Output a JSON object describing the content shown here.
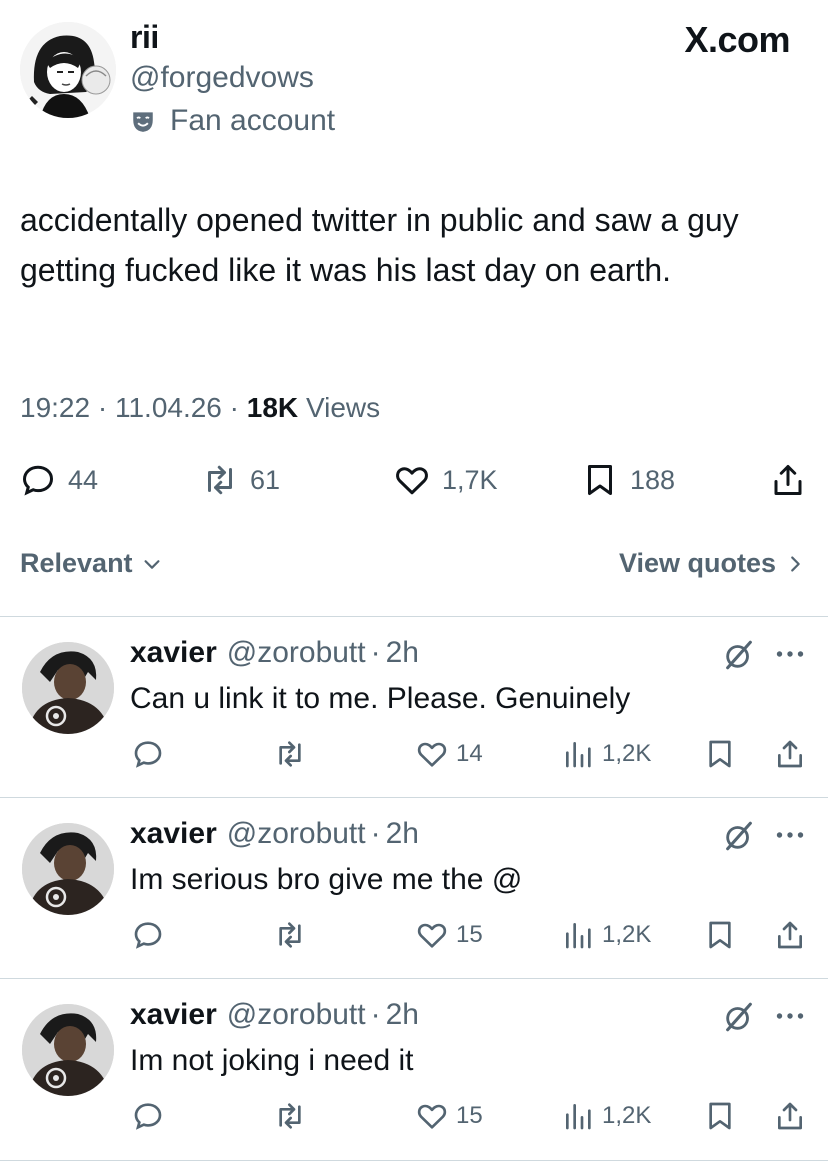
{
  "watermark": "X.com",
  "author": {
    "display_name": "rii",
    "handle": "@forgedvows",
    "badge_label": "Fan account"
  },
  "tweet": {
    "text": "accidentally opened twitter in public and saw a guy getting fucked like it was his last day on earth.",
    "time": "19:22",
    "date": "11.04.26",
    "separator": "·",
    "views_count": "18K",
    "views_label": "Views",
    "stats": {
      "replies": "44",
      "reposts": "61",
      "likes": "1,7K",
      "bookmarks": "188"
    }
  },
  "filter": {
    "sort_label": "Relevant",
    "view_quotes_label": "View quotes"
  },
  "replies": [
    {
      "name": "xavier",
      "handle": "@zorobutt",
      "dot": "·",
      "time": "2h",
      "text": "Can u link it to me. Please. Genuinely",
      "likes": "14",
      "views": "1,2K"
    },
    {
      "name": "xavier",
      "handle": "@zorobutt",
      "dot": "·",
      "time": "2h",
      "text": "Im serious bro give me the @",
      "likes": "15",
      "views": "1,2K"
    },
    {
      "name": "xavier",
      "handle": "@zorobutt",
      "dot": "·",
      "time": "2h",
      "text": "Im not joking i need it",
      "likes": "15",
      "views": "1,2K"
    }
  ],
  "icons": {
    "reply": "reply-icon",
    "repost": "repost-icon",
    "like": "heart-icon",
    "bookmark": "bookmark-icon",
    "share": "share-icon",
    "views": "views-chart-icon",
    "grok": "grok-icon",
    "more": "more-icon",
    "badge": "theater-mask-icon"
  },
  "colors": {
    "text": "#0f1419",
    "secondary": "#536471",
    "divider": "#cfd9de"
  }
}
